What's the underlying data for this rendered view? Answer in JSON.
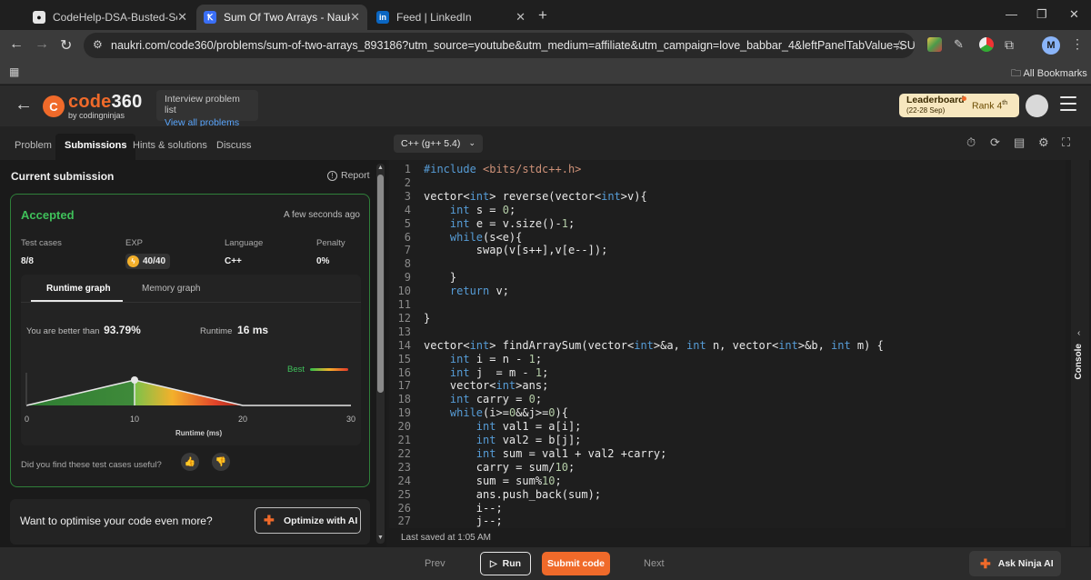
{
  "browser": {
    "tabs": [
      {
        "title": "CodeHelp-DSA-Busted-Series/L",
        "icon": "github-icon",
        "active": false
      },
      {
        "title": "Sum Of Two Arrays - Naukri Co",
        "icon": "naukri-icon",
        "active": true
      },
      {
        "title": "Feed | LinkedIn",
        "icon": "linkedin-icon",
        "active": false
      }
    ],
    "url": "naukri.com/code360/problems/sum-of-two-arrays_893186?utm_source=youtube&utm_medium=affiliate&utm_campaign=love_babbar_4&leftPanelTabValue=SUBMISSION",
    "profile_initial": "M",
    "all_bookmarks": "All Bookmarks"
  },
  "header": {
    "logo_text_main": "code",
    "logo_text_num": "360",
    "logo_byline": "by codingninjas",
    "interview_list_title": "Interview problem list",
    "interview_list_link": "View all problems",
    "leaderboard_label": "Leaderboard",
    "leaderboard_dates": "(22-28 Sep)",
    "rank_label": "Rank",
    "rank_value": "4",
    "rank_suffix": "th"
  },
  "left_tabs": [
    "Problem",
    "Submissions",
    "Hints & solutions",
    "Discuss"
  ],
  "submission": {
    "heading": "Current submission",
    "report": "Report",
    "status": "Accepted",
    "time": "A few seconds ago",
    "stats": [
      {
        "label": "Test cases",
        "value": "8/8"
      },
      {
        "label": "EXP",
        "value": "40/40"
      },
      {
        "label": "Language",
        "value": "C++"
      },
      {
        "label": "Penalty",
        "value": "0%"
      }
    ],
    "graph_tabs": [
      "Runtime graph",
      "Memory graph"
    ],
    "better_than_label": "You are better than",
    "better_than_value": "93.79%",
    "runtime_label": "Runtime",
    "runtime_value": "16 ms",
    "best_label": "Best",
    "x_ticks": [
      "0",
      "10",
      "20",
      "30"
    ],
    "x_axis_label": "Runtime (ms)",
    "feedback_question": "Did you find these test cases useful?"
  },
  "optimize": {
    "text": "Want to optimise your code even more?",
    "button": "Optimize with AI"
  },
  "editor": {
    "language": "C++ (g++ 5.4)",
    "last_saved": "Last saved at 1:05 AM",
    "console_label": "Console"
  },
  "bottom": {
    "prev": "Prev",
    "run": "Run",
    "submit": "Submit code",
    "next": "Next",
    "ask_ninja": "Ask Ninja AI"
  },
  "colors": {
    "accent": "#f06a2a",
    "accepted": "#3fc05a",
    "keyword": "#569cd6",
    "string": "#ce9178",
    "number": "#b5cea8"
  },
  "code_lines": [
    "#include <bits/stdc++.h>",
    "",
    "vector<int> reverse(vector<int>v){",
    "    int s = 0;",
    "    int e = v.size()-1;",
    "    while(s<e){",
    "        swap(v[s++],v[e--]);",
    "",
    "    }",
    "    return v;",
    "",
    "}",
    "",
    "vector<int> findArraySum(vector<int>&a, int n, vector<int>&b, int m) {",
    "    int i = n - 1;",
    "    int j  = m - 1;",
    "    vector<int>ans;",
    "    int carry = 0;",
    "    while(i>=0&&j>=0){",
    "        int val1 = a[i];",
    "        int val2 = b[j];",
    "        int sum = val1 + val2 +carry;",
    "        carry = sum/10;",
    "        sum = sum%10;",
    "        ans.push_back(sum);",
    "        i--;",
    "        j--;"
  ]
}
